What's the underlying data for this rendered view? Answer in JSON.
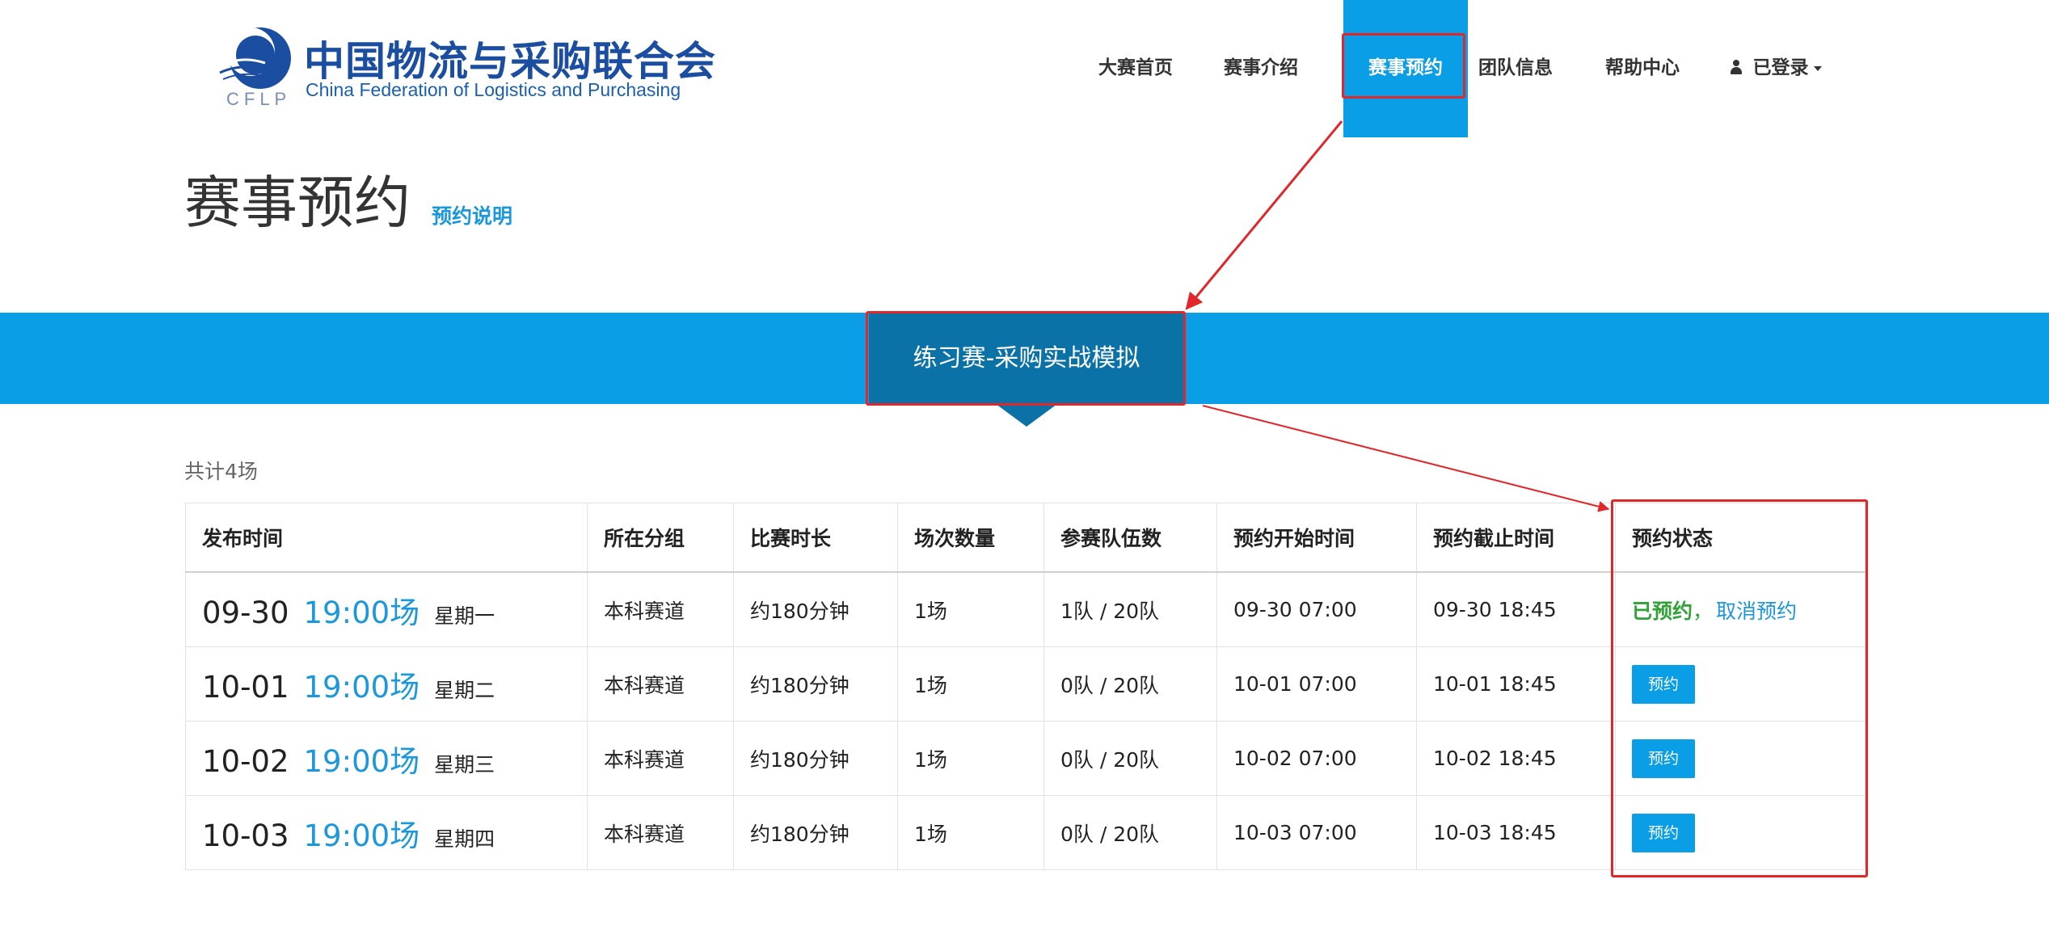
{
  "logo": {
    "cn_text": "中国物流与采购联合会",
    "en_text": "China Federation of Logistics and Purchasing",
    "abbr": "CFLP"
  },
  "nav": {
    "items": [
      {
        "label": "大赛首页"
      },
      {
        "label": "赛事介绍"
      },
      {
        "label": "赛事预约",
        "active": true
      },
      {
        "label": "团队信息"
      },
      {
        "label": "帮助中心"
      }
    ],
    "user_label": "已登录",
    "user_icon": "user-icon"
  },
  "page": {
    "title": "赛事预约",
    "help_link": "预约说明"
  },
  "competition_tab": {
    "label": "练习赛-采购实战模拟"
  },
  "table": {
    "total": "共计4场",
    "headers": [
      "发布时间",
      "所在分组",
      "比赛时长",
      "场次数量",
      "参赛队伍数",
      "预约开始时间",
      "预约截止时间",
      "预约状态"
    ],
    "rows": [
      {
        "date": "09-30",
        "time": "19:00场",
        "weekday": "星期一",
        "group": "本科赛道",
        "duration": "约180分钟",
        "count": "1场",
        "teams": "1队 / 20队",
        "start": "09-30 07:00",
        "end": "09-30 18:45",
        "status_booked": "已预约",
        "status_sep": "，",
        "status_cancel": "取消预约"
      },
      {
        "date": "10-01",
        "time": "19:00场",
        "weekday": "星期二",
        "group": "本科赛道",
        "duration": "约180分钟",
        "count": "1场",
        "teams": "0队 / 20队",
        "start": "10-01 07:00",
        "end": "10-01 18:45",
        "status_button": "预约"
      },
      {
        "date": "10-02",
        "time": "19:00场",
        "weekday": "星期三",
        "group": "本科赛道",
        "duration": "约180分钟",
        "count": "1场",
        "teams": "0队 / 20队",
        "start": "10-02 07:00",
        "end": "10-02 18:45",
        "status_button": "预约"
      },
      {
        "date": "10-03",
        "time": "19:00场",
        "weekday": "星期四",
        "group": "本科赛道",
        "duration": "约180分钟",
        "count": "1场",
        "teams": "0队 / 20队",
        "start": "10-03 07:00",
        "end": "10-03 18:45",
        "status_button": "预约"
      }
    ]
  },
  "colors": {
    "primary": "#0a9ee6",
    "tab_active": "#0b72a8",
    "link": "#1b97db",
    "booked": "#2fa336",
    "annotation": "#e1272a"
  }
}
